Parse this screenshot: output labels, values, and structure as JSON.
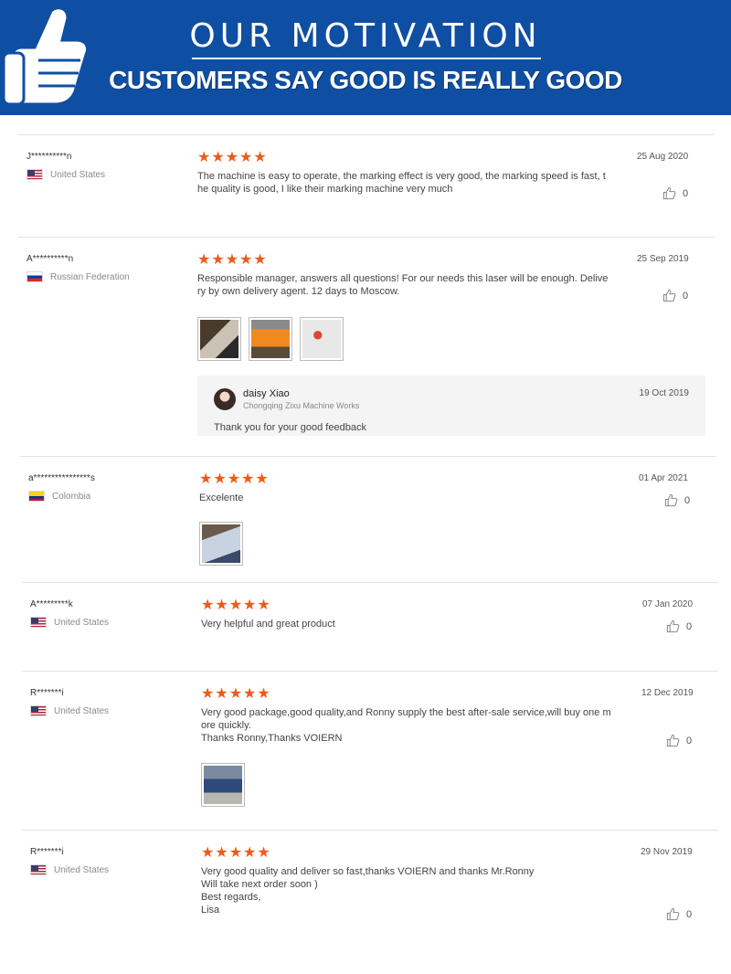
{
  "banner": {
    "title": "OUR MOTIVATION",
    "subtitle": "CUSTOMERS SAY GOOD  IS REALLY GOOD"
  },
  "reviews": [
    {
      "user": "J**********n",
      "country": "United States",
      "flag": "us",
      "stars": 5,
      "date": "25 Aug 2020",
      "text": "The machine is easy to operate, the marking effect is very good, the marking speed is fast, t\nhe quality is good, I like their marking machine very much",
      "likes": "0"
    },
    {
      "user": "A**********n",
      "country": "Russian Federation",
      "flag": "ru",
      "stars": 5,
      "date": "25 Sep 2019",
      "text": "Responsible manager, answers all questions! For our needs this laser will be enough. Delive\nry by own delivery agent. 12 days to Moscow.",
      "likes": "0",
      "photos": 3,
      "reply": {
        "name": "daisy Xiao",
        "company": "Chongqing Zixu Machine Works",
        "date": "19 Oct 2019",
        "text": "Thank you for your good feedback"
      }
    },
    {
      "user": "a****************s",
      "country": "Colombia",
      "flag": "co",
      "stars": 5,
      "date": "01 Apr 2021",
      "text": "Excelente",
      "likes": "0",
      "photos": 1
    },
    {
      "user": "A*********k",
      "country": "United States",
      "flag": "us",
      "stars": 5,
      "date": "07 Jan 2020",
      "text": "Very helpful and great product",
      "likes": "0"
    },
    {
      "user": "R*******i",
      "country": "United States",
      "flag": "us",
      "stars": 5,
      "date": "12 Dec 2019",
      "text": "Very good package,good quality,and Ronny supply the best after-sale service,will buy one m\nore quickly.\nThanks Ronny,Thanks VOIERN",
      "likes": "0",
      "photos": 1
    },
    {
      "user": "R*******i",
      "country": "United States",
      "flag": "us",
      "stars": 5,
      "date": "29 Nov 2019",
      "text": "Very good quality and deliver so fast,thanks VOIERN and thanks Mr.Ronny\nWill take next order soon )\nBest regards,\nLisa",
      "likes": "0"
    }
  ],
  "colors": {
    "banner": "#0f4fa3",
    "star": "#f05a18",
    "reply_bg": "#f4f4f4"
  },
  "icons": {
    "banner": "thumbs-up-fist-icon",
    "like": "thumbs-up-outline-icon",
    "star": "star-icon"
  }
}
